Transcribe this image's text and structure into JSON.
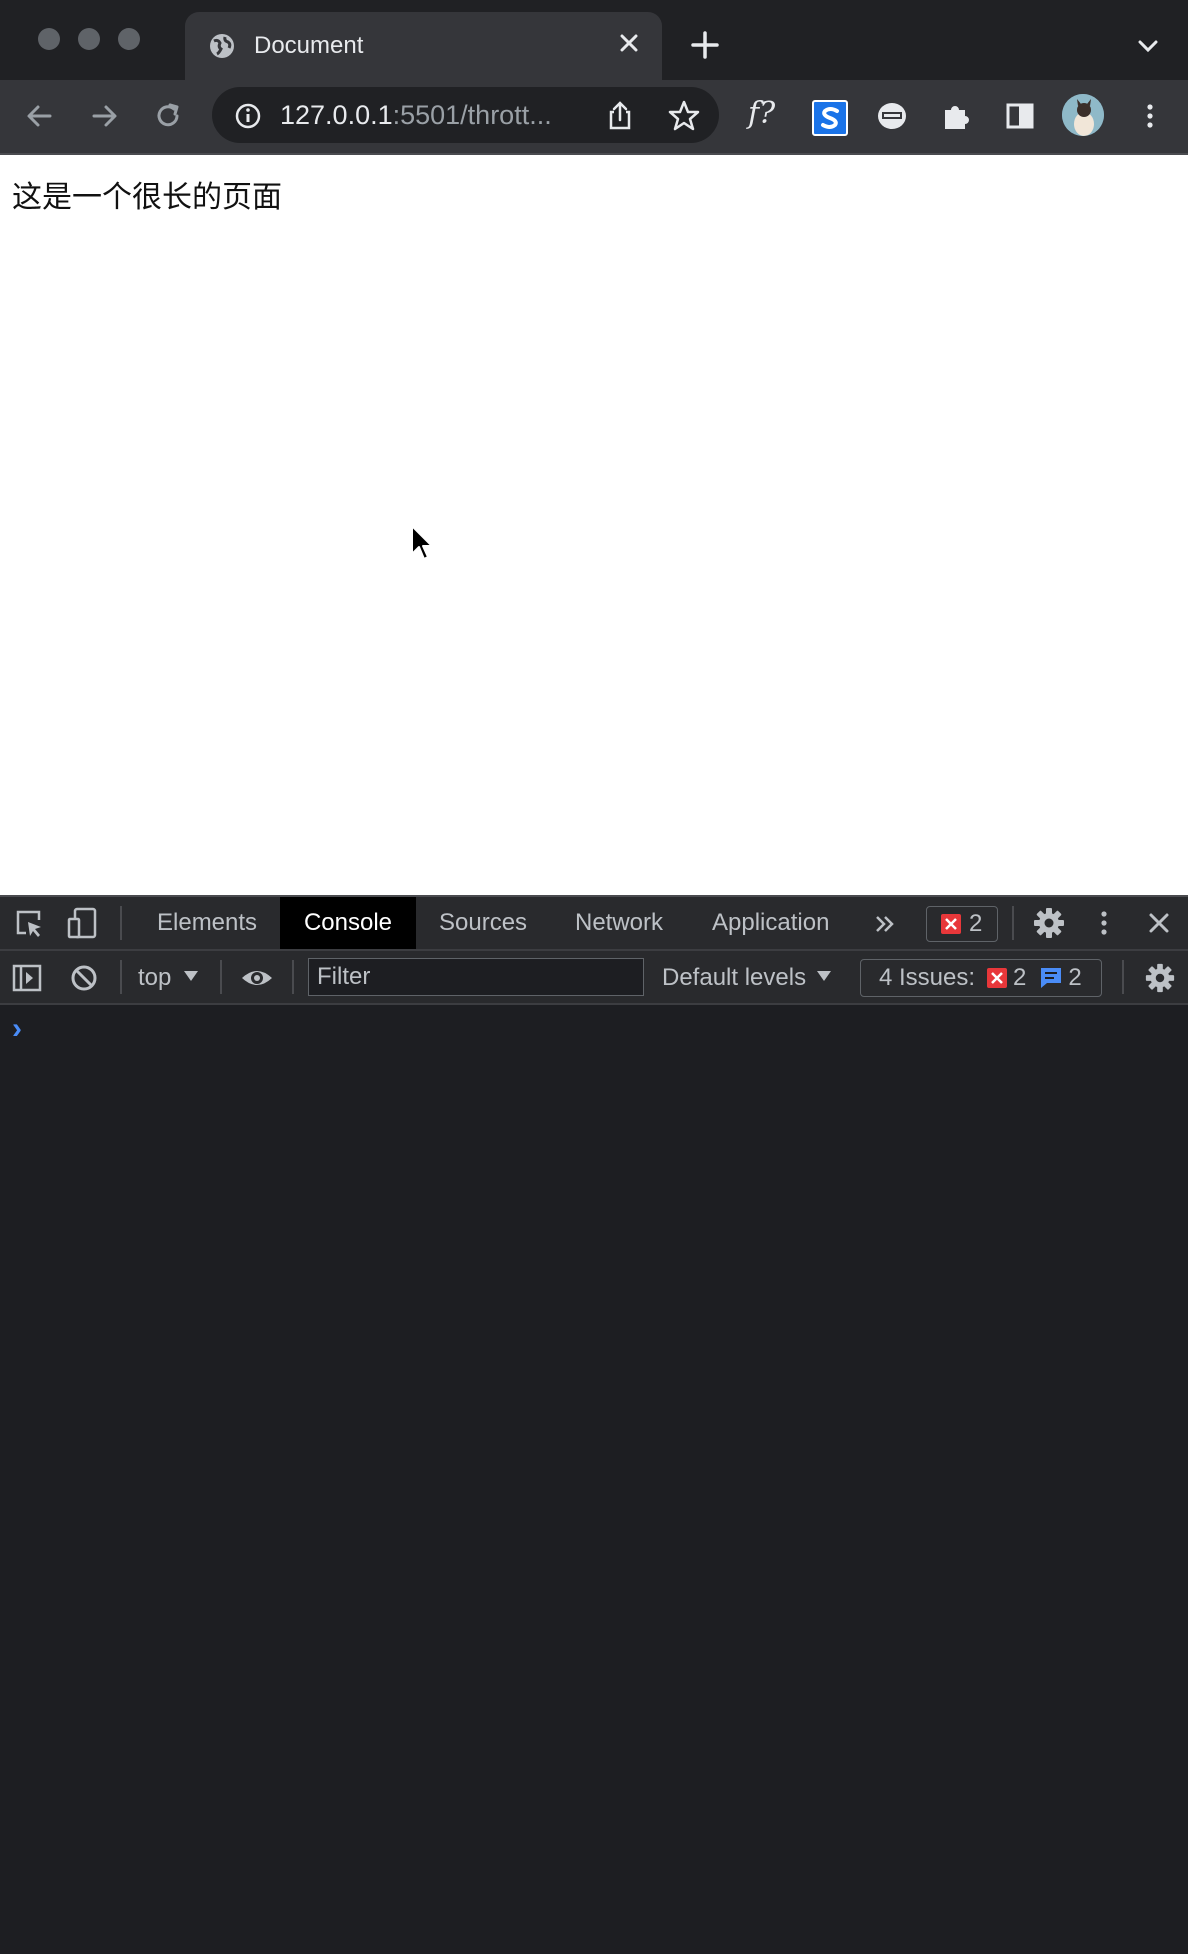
{
  "browser": {
    "tab": {
      "title": "Document"
    },
    "address_bar": {
      "url_host": "127.0.0.1",
      "url_rest": ":5501/thrott..."
    },
    "extensions": {
      "f_label": "f?"
    }
  },
  "page": {
    "text": "这是一个很长的页面"
  },
  "devtools": {
    "tabs": [
      "Elements",
      "Console",
      "Sources",
      "Network",
      "Application"
    ],
    "active_tab": "Console",
    "error_count": "2",
    "console": {
      "context": "top",
      "filter_placeholder": "Filter",
      "levels": "Default levels",
      "issues_label": "4 Issues:",
      "issues_errors": "2",
      "issues_info": "2",
      "prompt": "›"
    }
  },
  "colors": {
    "accent_error": "#e8373a",
    "accent_info": "#4a8cf7",
    "prompt": "#4a8cf7"
  }
}
